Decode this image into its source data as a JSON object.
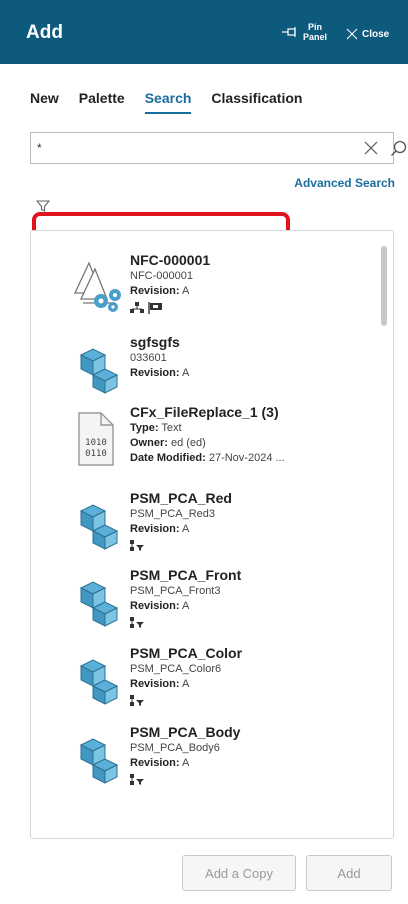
{
  "header": {
    "title": "Add",
    "pin_label_line1": "Pin",
    "pin_label_line2": "Panel",
    "close_label": "Close",
    "color": "#0e5a7d"
  },
  "tabs": [
    {
      "label": "New",
      "active": false
    },
    {
      "label": "Palette",
      "active": false
    },
    {
      "label": "Search",
      "active": true
    },
    {
      "label": "Classification",
      "active": false
    }
  ],
  "search": {
    "value": "*",
    "advanced_label": "Advanced Search"
  },
  "results": [
    {
      "name": "NFC-000001",
      "subtitle": "NFC-000001",
      "revision_label": "Revision:",
      "revision": "A",
      "icon": "assembly-icon"
    },
    {
      "name": "sgfsgfs",
      "subtitle": "033601",
      "revision_label": "Revision:",
      "revision": "A",
      "icon": "part-icon"
    },
    {
      "name": "CFx_FileReplace_1 (3)",
      "type_label": "Type:",
      "type": "Text",
      "owner_label": "Owner:",
      "owner": "ed (ed)",
      "date_label": "Date Modified:",
      "date": "27-Nov-2024 ...",
      "icon": "binary-file-icon",
      "binary_text": "1010\n0110"
    },
    {
      "name": "PSM_PCA_Red",
      "subtitle": "PSM_PCA_Red3",
      "revision_label": "Revision:",
      "revision": "A",
      "icon": "part-icon"
    },
    {
      "name": "PSM_PCA_Front",
      "subtitle": "PSM_PCA_Front3",
      "revision_label": "Revision:",
      "revision": "A",
      "icon": "part-icon"
    },
    {
      "name": "PSM_PCA_Color",
      "subtitle": "PSM_PCA_Color6",
      "revision_label": "Revision:",
      "revision": "A",
      "icon": "part-icon"
    },
    {
      "name": "PSM_PCA_Body",
      "subtitle": "PSM_PCA_Body6",
      "revision_label": "Revision:",
      "revision": "A",
      "icon": "part-icon"
    }
  ],
  "footer": {
    "add_copy_label": "Add a Copy",
    "add_label": "Add"
  },
  "colors": {
    "accent": "#1a6e9e",
    "annotation": "#e0141e"
  }
}
